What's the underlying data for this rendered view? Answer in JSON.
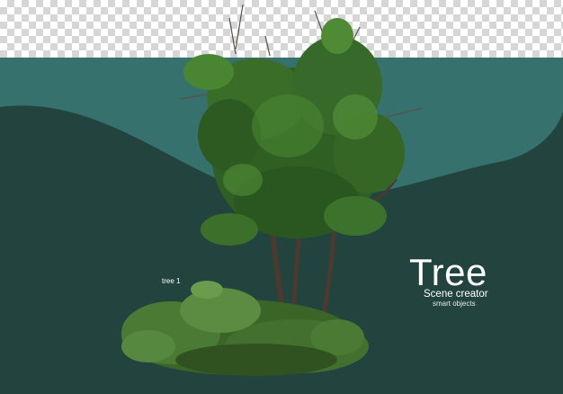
{
  "title": "Tree",
  "subtitle": "Scene creator",
  "tagline": "smart objects",
  "object_label": "tree 1",
  "colors": {
    "upper_band": "#36716e",
    "lower_band": "#23433f",
    "foliage": "#3f7a2d",
    "trunk": "#4a3a30"
  },
  "icons": {
    "transparency": "checkerboard-pattern",
    "object": "tree-illustration"
  }
}
